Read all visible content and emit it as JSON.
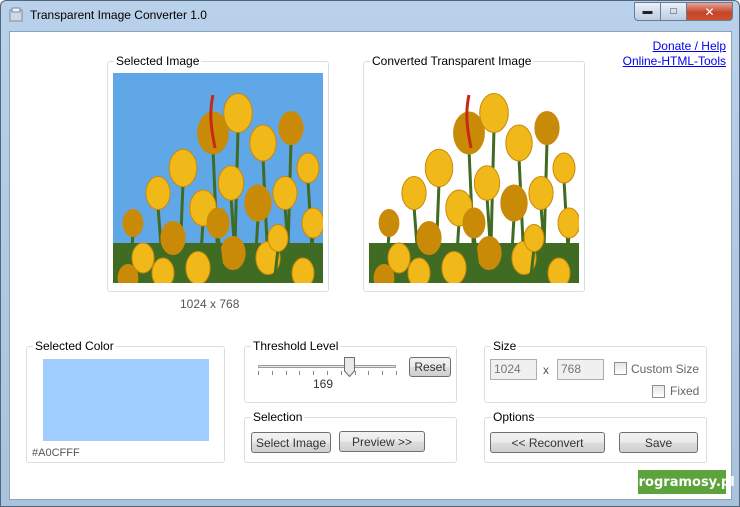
{
  "window": {
    "title": "Transparent Image Converter 1.0",
    "controls": {
      "minimize": "▬",
      "maximize": "□",
      "close": "✕"
    }
  },
  "links": {
    "donate": "Donate / Help",
    "online_tools": "Online-HTML-Tools"
  },
  "selected_image": {
    "label": "Selected Image",
    "dimensions": "1024 x 768"
  },
  "converted_image": {
    "label": "Converted Transparent Image"
  },
  "selected_color": {
    "label": "Selected Color",
    "hex": "#A0CFFF",
    "swatch_color": "#A0CFFF"
  },
  "threshold": {
    "label": "Threshold Level",
    "value": "169",
    "level_fraction": 0.66,
    "reset_label": "Reset"
  },
  "selection": {
    "label": "Selection",
    "select_image_label": "Select Image",
    "preview_label": "Preview >>"
  },
  "size": {
    "label": "Size",
    "width": "1024",
    "height": "768",
    "separator": "x",
    "custom_size_label": "Custom Size",
    "fixed_label": "Fixed",
    "custom_size_checked": false,
    "fixed_checked": false
  },
  "options": {
    "label": "Options",
    "reconvert_label": "<< Reconvert",
    "save_label": "Save"
  },
  "watermark": {
    "text": "programosy.pl"
  },
  "colors": {
    "sky": "#5fa7e6",
    "petal": "#f1b81a",
    "petal_dark": "#c98a08",
    "stem": "#3f6b22",
    "accent_red": "#c62a12"
  }
}
